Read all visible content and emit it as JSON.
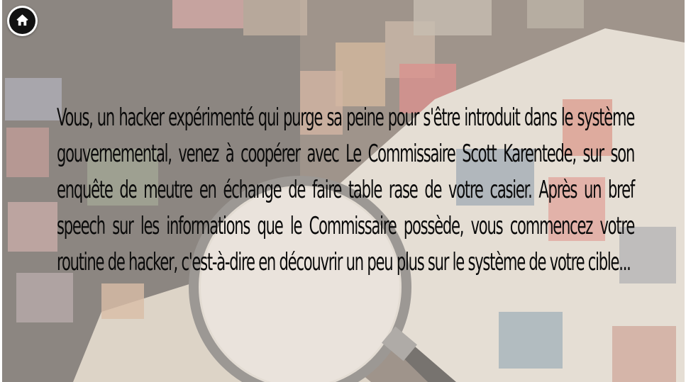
{
  "home": {
    "icon": "home-icon",
    "fill": "#111111",
    "ring": "#ffffff"
  },
  "story": {
    "text": "Vous, un hacker expérimenté qui purge sa peine pour s'être introduit dans le système gouvernemental, venez à coopérer avec Le Commissaire Scott Karentede, sur son enquête de meutre en échange de faire table rase de votre casier. Après un bref speech sur les informations que le Commissaire possède, vous commencez votre routine de hacker, c'est-à-dire en découvrir un peu plus sur le système de votre cible..."
  },
  "background": {
    "description_icon": "stamps-and-magnifying-glass-photo",
    "tint": "#7d6f66"
  }
}
